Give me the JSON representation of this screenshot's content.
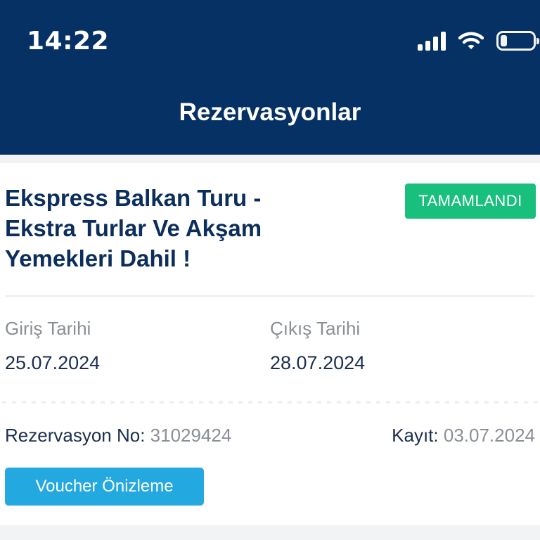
{
  "status_bar": {
    "time": "14:22",
    "icons": [
      "signal-icon",
      "wifi-icon",
      "battery-icon"
    ]
  },
  "header": {
    "title": "Rezervasyonlar",
    "background": "#063165"
  },
  "reservation": {
    "title": "Ekspress Balkan Turu - Ekstra Turlar Ve Akşam Yemekleri Dahil !",
    "status": "TAMAMLANDI",
    "status_color": "#18bf7d",
    "checkin_label": "Giriş Tarihi",
    "checkin_date": "25.07.2024",
    "checkout_label": "Çıkış Tarihi",
    "checkout_date": "28.07.2024",
    "reservation_no_label": "Rezervasyon No:",
    "reservation_no": "31029424",
    "record_label": "Kayıt:",
    "record_date": "03.07.2024",
    "voucher_button": "Voucher Önizleme",
    "voucher_color": "#24a8e0"
  }
}
